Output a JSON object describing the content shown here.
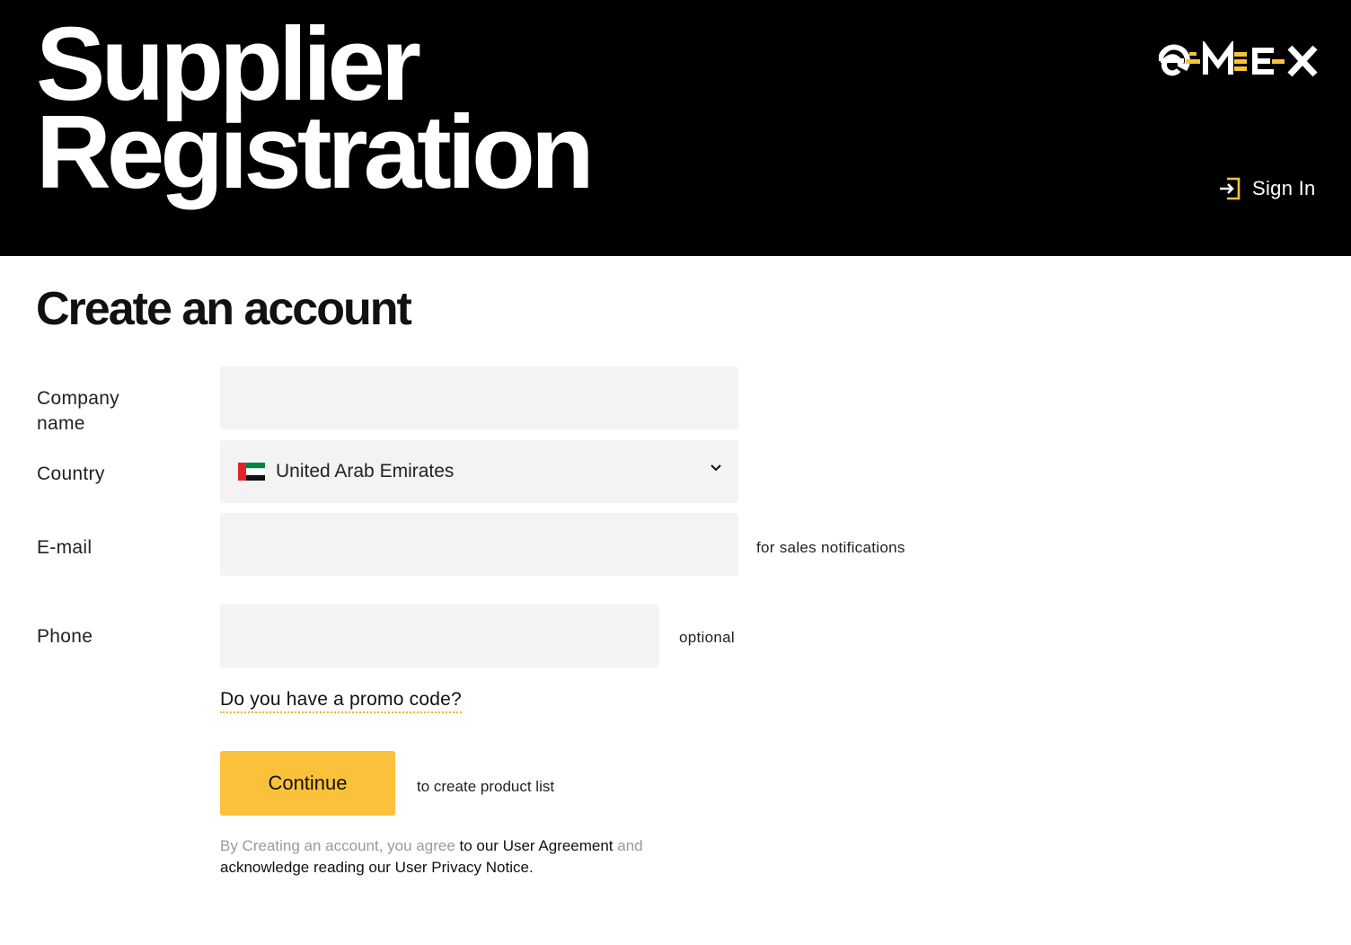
{
  "header": {
    "title_line1": "Supplier",
    "title_line2": "Registration",
    "logo_text": "EMEX",
    "sign_in_label": "Sign In",
    "accent_color": "#fcc13a"
  },
  "page_title": "Create an account",
  "form": {
    "company": {
      "label": "Company name",
      "value": "",
      "placeholder": ""
    },
    "country": {
      "label": "Country",
      "value": "United Arab Emirates",
      "flag": "uae-flag-icon"
    },
    "email": {
      "label": "E-mail",
      "value": "",
      "placeholder": "",
      "hint": "for sales notifications"
    },
    "phone": {
      "label": "Phone",
      "value": "",
      "placeholder": "",
      "hint": "optional"
    },
    "promo_link": "Do you have a promo code?",
    "continue_label": "Continue",
    "continue_note": "to create product list"
  },
  "legal": {
    "part1": "By Creating an account, you agree ",
    "agreement_link": "to our User Agreement",
    "part2": " and",
    "privacy_text": "acknowledge reading our User Privacy Notice."
  }
}
